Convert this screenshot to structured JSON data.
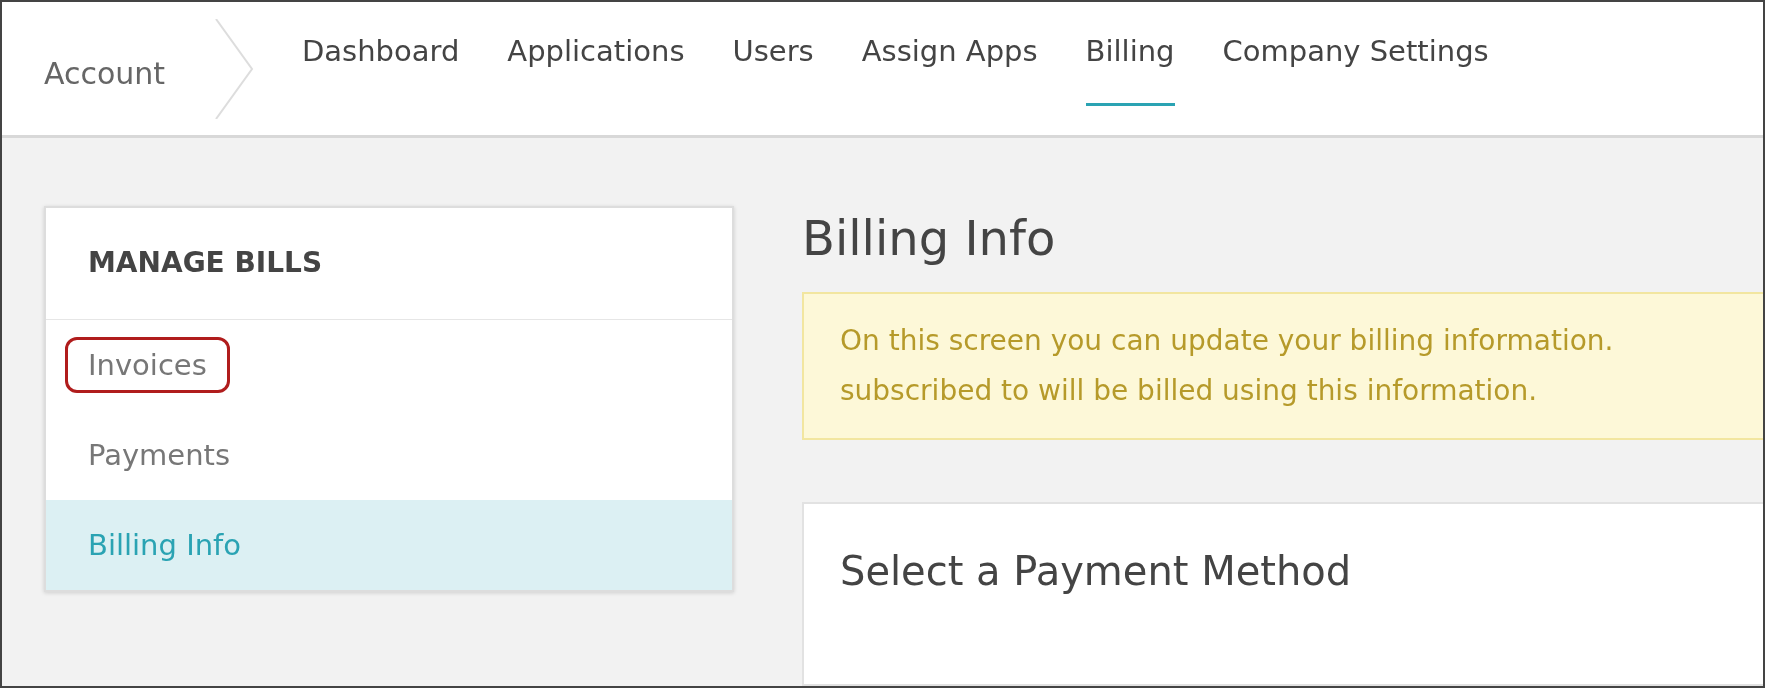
{
  "breadcrumb": "Account",
  "nav": [
    {
      "label": "Dashboard",
      "selected": false
    },
    {
      "label": "Applications",
      "selected": false
    },
    {
      "label": "Users",
      "selected": false
    },
    {
      "label": "Assign Apps",
      "selected": false
    },
    {
      "label": "Billing",
      "selected": true
    },
    {
      "label": "Company Settings",
      "selected": false
    }
  ],
  "sidebar": {
    "title": "MANAGE BILLS",
    "items": [
      {
        "label": "Invoices",
        "selected": false,
        "highlighted": true
      },
      {
        "label": "Payments",
        "selected": false,
        "highlighted": false
      },
      {
        "label": "Billing Info",
        "selected": true,
        "highlighted": false
      }
    ]
  },
  "main": {
    "title": "Billing Info",
    "notice": [
      "On this screen you can update your billing information.",
      "subscribed to will be billed using this information."
    ],
    "card_title": "Select a Payment Method"
  }
}
